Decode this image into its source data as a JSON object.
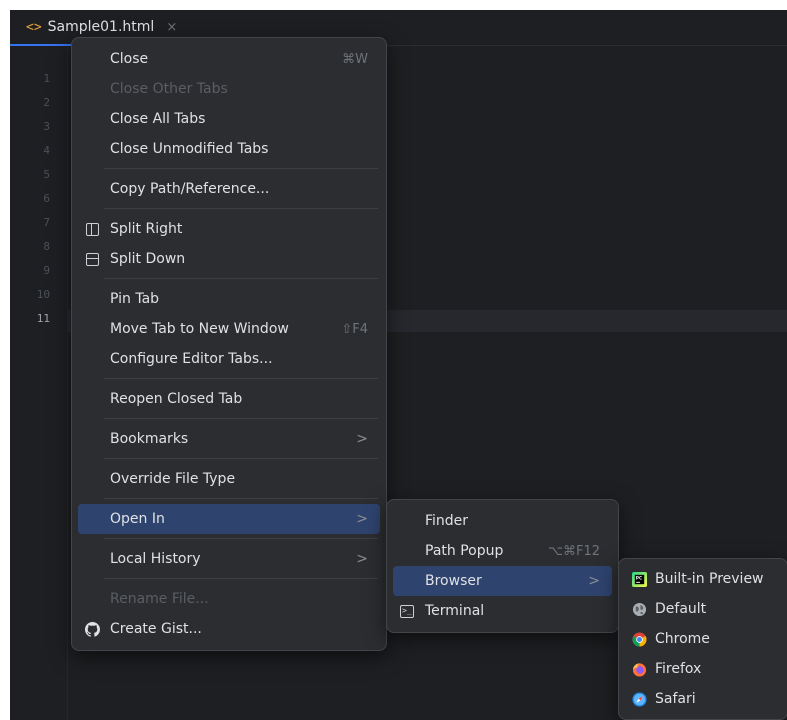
{
  "tab": {
    "icon": "html-file-icon",
    "title": "Sample01.html",
    "close_glyph": "×"
  },
  "gutter": {
    "lines": [
      "1",
      "2",
      "3",
      "4",
      "5",
      "6",
      "7",
      "8",
      "9",
      "10",
      "11"
    ],
    "current_line": "11"
  },
  "context_menu": {
    "close": {
      "label": "Close",
      "shortcut": "⌘W"
    },
    "close_other": {
      "label": "Close Other Tabs"
    },
    "close_all": {
      "label": "Close All Tabs"
    },
    "close_unmodified": {
      "label": "Close Unmodified Tabs"
    },
    "copy_path": {
      "label": "Copy Path/Reference..."
    },
    "split_right": {
      "label": "Split Right",
      "icon": "split-vertical-icon"
    },
    "split_down": {
      "label": "Split Down",
      "icon": "split-horizontal-icon"
    },
    "pin_tab": {
      "label": "Pin Tab"
    },
    "move_tab": {
      "label": "Move Tab to New Window",
      "shortcut": "⇧F4"
    },
    "configure_tabs": {
      "label": "Configure Editor Tabs..."
    },
    "reopen_closed": {
      "label": "Reopen Closed Tab"
    },
    "bookmarks": {
      "label": "Bookmarks",
      "arrow": ">"
    },
    "override_type": {
      "label": "Override File Type"
    },
    "open_in": {
      "label": "Open In",
      "arrow": ">"
    },
    "local_history": {
      "label": "Local History",
      "arrow": ">"
    },
    "rename_file": {
      "label": "Rename File..."
    },
    "create_gist": {
      "label": "Create Gist...",
      "icon": "github-icon"
    }
  },
  "open_in_menu": {
    "finder": {
      "label": "Finder"
    },
    "path_popup": {
      "label": "Path Popup",
      "shortcut": "⌥⌘F12"
    },
    "browser": {
      "label": "Browser",
      "arrow": ">"
    },
    "terminal": {
      "label": "Terminal",
      "icon": "terminal-icon"
    }
  },
  "browser_menu": {
    "builtin_preview": {
      "label": "Built-in Preview",
      "icon": "pycharm-icon"
    },
    "default": {
      "label": "Default",
      "icon": "globe-icon"
    },
    "chrome": {
      "label": "Chrome",
      "icon": "chrome-icon"
    },
    "firefox": {
      "label": "Firefox",
      "icon": "firefox-icon"
    },
    "safari": {
      "label": "Safari",
      "icon": "safari-icon"
    }
  },
  "colors": {
    "background": "#1e1f22",
    "menu": "#2b2d30",
    "selection": "#2e436e",
    "accent": "#3574f0"
  }
}
